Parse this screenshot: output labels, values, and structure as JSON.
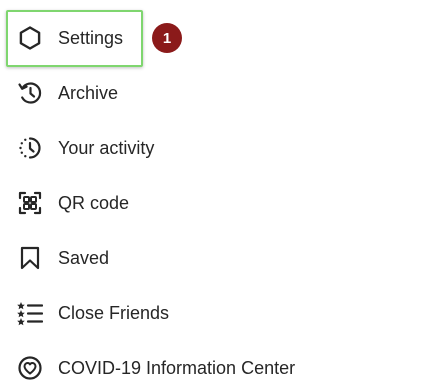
{
  "menu": {
    "items": [
      {
        "label": "Settings",
        "icon": "settings-icon"
      },
      {
        "label": "Archive",
        "icon": "archive-icon"
      },
      {
        "label": "Your activity",
        "icon": "activity-icon"
      },
      {
        "label": "QR code",
        "icon": "qr-code-icon"
      },
      {
        "label": "Saved",
        "icon": "bookmark-icon"
      },
      {
        "label": "Close Friends",
        "icon": "close-friends-icon"
      },
      {
        "label": "COVID-19 Information Center",
        "icon": "covid-info-icon"
      }
    ]
  },
  "annotation": {
    "step_number": "1",
    "highlight_color": "#7fd66f",
    "badge_color": "#8b1a1a"
  }
}
